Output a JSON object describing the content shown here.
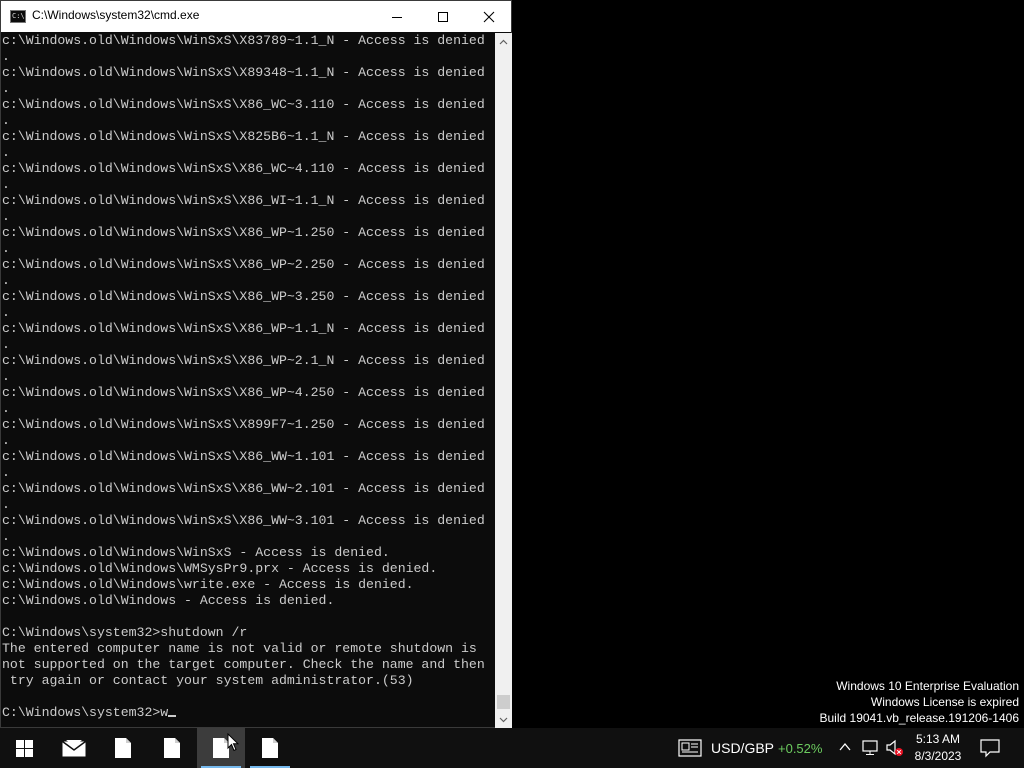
{
  "window": {
    "title": "C:\\Windows\\system32\\cmd.exe"
  },
  "console": {
    "lines": [
      "c:\\Windows.old\\Windows\\WinSxS\\X83789~1.1_N - Access is denied",
      ".",
      "c:\\Windows.old\\Windows\\WinSxS\\X89348~1.1_N - Access is denied",
      ".",
      "c:\\Windows.old\\Windows\\WinSxS\\X86_WC~3.110 - Access is denied",
      ".",
      "c:\\Windows.old\\Windows\\WinSxS\\X825B6~1.1_N - Access is denied",
      ".",
      "c:\\Windows.old\\Windows\\WinSxS\\X86_WC~4.110 - Access is denied",
      ".",
      "c:\\Windows.old\\Windows\\WinSxS\\X86_WI~1.1_N - Access is denied",
      ".",
      "c:\\Windows.old\\Windows\\WinSxS\\X86_WP~1.250 - Access is denied",
      ".",
      "c:\\Windows.old\\Windows\\WinSxS\\X86_WP~2.250 - Access is denied",
      ".",
      "c:\\Windows.old\\Windows\\WinSxS\\X86_WP~3.250 - Access is denied",
      ".",
      "c:\\Windows.old\\Windows\\WinSxS\\X86_WP~1.1_N - Access is denied",
      ".",
      "c:\\Windows.old\\Windows\\WinSxS\\X86_WP~2.1_N - Access is denied",
      ".",
      "c:\\Windows.old\\Windows\\WinSxS\\X86_WP~4.250 - Access is denied",
      ".",
      "c:\\Windows.old\\Windows\\WinSxS\\X899F7~1.250 - Access is denied",
      ".",
      "c:\\Windows.old\\Windows\\WinSxS\\X86_WW~1.101 - Access is denied",
      ".",
      "c:\\Windows.old\\Windows\\WinSxS\\X86_WW~2.101 - Access is denied",
      ".",
      "c:\\Windows.old\\Windows\\WinSxS\\X86_WW~3.101 - Access is denied",
      ".",
      "c:\\Windows.old\\Windows\\WinSxS - Access is denied.",
      "c:\\Windows.old\\Windows\\WMSysPr9.prx - Access is denied.",
      "c:\\Windows.old\\Windows\\write.exe - Access is denied.",
      "c:\\Windows.old\\Windows - Access is denied.",
      "",
      "C:\\Windows\\system32>shutdown /r",
      "The entered computer name is not valid or remote shutdown is",
      "not supported on the target computer. Check the name and then",
      " try again or contact your system administrator.(53)",
      ""
    ],
    "prompt": "C:\\Windows\\system32>",
    "input_value": "w"
  },
  "watermark": {
    "edition": "Windows 10 Enterprise Evaluation",
    "license": "Windows License is expired",
    "build": "Build 19041.vb_release.191206-1406"
  },
  "taskbar": {
    "items": [
      {
        "name": "start-button",
        "icon": "windows-logo-icon"
      },
      {
        "name": "mail-app",
        "icon": "mail-icon"
      },
      {
        "name": "file-app-1",
        "icon": "document-icon"
      },
      {
        "name": "file-app-2",
        "icon": "document-icon"
      },
      {
        "name": "file-app-3",
        "icon": "document-icon",
        "active": true
      },
      {
        "name": "file-app-4",
        "icon": "document-icon",
        "underlined": true
      }
    ],
    "tray": {
      "currency_pair": "USD/GBP",
      "currency_change": "+0.52%",
      "time": "5:13 AM",
      "date": "8/3/2023"
    }
  },
  "colors": {
    "console_bg": "#0c0c0c",
    "console_text": "#cccccc",
    "taskbar_bg": "#101010",
    "accent": "#76b9ed",
    "positive_change": "#6ccb5f"
  }
}
